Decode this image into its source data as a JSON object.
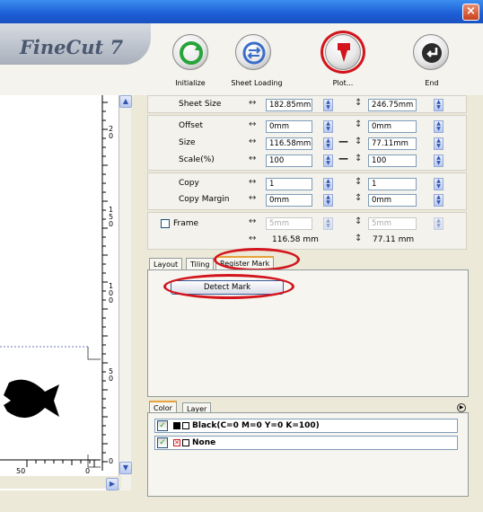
{
  "app": {
    "logo_text": "FineCut 7",
    "close": "×"
  },
  "toolbar": {
    "initialize": "Initialize",
    "sheet_loading": "Sheet Loading",
    "plot": "Plot...",
    "end": "End"
  },
  "ruler": {
    "marks": [
      "2\n0",
      "1\n5\n0",
      "1\n0\n0",
      "5\n0",
      "0"
    ],
    "bottom_left": "50",
    "bottom_mid": "0"
  },
  "params": {
    "sheet_size": {
      "label": "Sheet Size",
      "w": "182.85mm",
      "h": "246.75mm"
    },
    "offset": {
      "label": "Offset",
      "w": "0mm",
      "h": "0mm"
    },
    "size": {
      "label": "Size",
      "w": "116.58mm",
      "h": "77.11mm"
    },
    "scale": {
      "label": "Scale(%)",
      "w": "100",
      "h": "100"
    },
    "copy": {
      "label": "Copy",
      "w": "1",
      "h": "1"
    },
    "copy_margin": {
      "label": "Copy Margin",
      "w": "0mm",
      "h": "0mm"
    },
    "frame": {
      "label": "Frame",
      "w": "5mm",
      "h": "5mm"
    },
    "summary": {
      "w": "116.58 mm",
      "h": "77.11 mm"
    }
  },
  "tabs": {
    "layout": "Layout",
    "tiling": "Tiling",
    "register_mark": "Register Mark"
  },
  "register": {
    "detect_mark": "Detect Mark"
  },
  "color_tabs": {
    "color": "Color",
    "layer": "Layer"
  },
  "colors": [
    {
      "name": "Black(C=0 M=0 Y=0 K=100)"
    },
    {
      "name": "None"
    }
  ],
  "accent": {
    "highlight": "#d3141c",
    "title": "#1d5ed6"
  }
}
